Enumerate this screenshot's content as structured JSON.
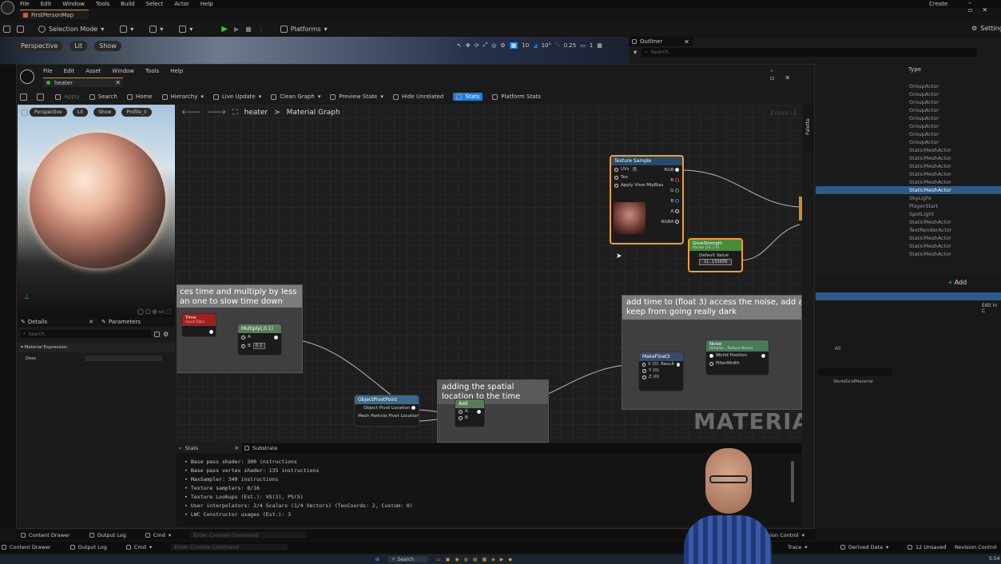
{
  "editor": {
    "menu": [
      "File",
      "Edit",
      "Window",
      "Tools",
      "Build",
      "Select",
      "Actor",
      "Help"
    ],
    "map_tab": "FirstPersonMap",
    "create": "Create",
    "selection_mode": "Selection Mode",
    "platforms": "Platforms",
    "settings": "Settings",
    "viewport_buttons": [
      "Perspective",
      "Lit",
      "Show"
    ],
    "outliner_title": "Outliner",
    "outliner_search": "Search",
    "type_header": "Type",
    "outliner_rows": [
      "GroupActor",
      "GroupActor",
      "GroupActor",
      "GroupActor",
      "GroupActor",
      "GroupActor",
      "GroupActor",
      "GroupActor",
      "StaticMeshActor",
      "StaticMeshActor",
      "StaticMeshActor",
      "StaticMeshActor",
      "StaticMeshActor",
      "StaticMeshActor",
      "SkyLight",
      "PlayerStart",
      "SpotLight",
      "StaticMeshActor",
      "TextRenderActor",
      "StaticMeshActor",
      "StaticMeshActor",
      "StaticMeshActor"
    ],
    "selected_row": 13,
    "add_label": "Add",
    "all_label": "All",
    "edit_in": "Edit in C",
    "world_grid": "WorldGridMaterial",
    "bottom": {
      "content_drawer": "Content Drawer",
      "output_log": "Output Log",
      "cmd": "Cmd",
      "console_placeholder": "Enter Console Command",
      "trace": "Trace",
      "derived_data": "Derived Data",
      "unsaved": "12 Unsaved",
      "revision_control": "Revision Control"
    },
    "taskbar_search": "Search",
    "clock": "5:54"
  },
  "mat": {
    "menu": [
      "File",
      "Edit",
      "Asset",
      "Window",
      "Tools",
      "Help"
    ],
    "tab": "heater",
    "toolbar": [
      "Apply",
      "Search",
      "Home",
      "Hierarchy",
      "Live Update",
      "Clean Graph",
      "Preview State",
      "Hide Unrelated",
      "Stats",
      "Platform Stats"
    ],
    "preview_buttons": [
      "Perspective",
      "Lit",
      "Show",
      "Profile_0"
    ],
    "breadcrumb": {
      "root": "heater",
      "sep": ">",
      "leaf": "Material Graph"
    },
    "zoom": "Zoom -1",
    "palette": "Palette",
    "details": {
      "tab": "Details",
      "params_tab": "Parameters",
      "search": "Search",
      "section": "Material Expression",
      "desc": "Desc"
    },
    "comments": {
      "c1": "ces time and multiply by less\nan one to slow time down",
      "c2": "adding the spatial\nlocation to the time",
      "c3": "add time to (float 3) access the noise, add a f\nkeep from going really dark"
    },
    "watermark": "MATERIAL",
    "nodes": {
      "texture": {
        "title": "Texture Sample",
        "uvs": "UVs",
        "uvs_val": "0",
        "tex": "Tex",
        "apply": "Apply View MipBias",
        "outs": [
          "RGB",
          "R",
          "G",
          "B",
          "A",
          "RGBA"
        ]
      },
      "glow": {
        "title": "GlowStrength",
        "sub": "Param (11.1.0)",
        "label": "Default Value",
        "value": "11.133099"
      },
      "time": {
        "title": "Time",
        "sub": "Input Data"
      },
      "multiply": {
        "title": "Multiply(,0.1)",
        "a": "A",
        "b": "B",
        "b_val": "0.1"
      },
      "objpivot": {
        "title": "ObjectPivotPoint",
        "o1": "Object Pivot Location",
        "o2": "Mesh Particle Pivot Location"
      },
      "add": {
        "title": "Add",
        "a": "A",
        "b": "B"
      },
      "make": {
        "title": "MakeFloat3",
        "x": "X (0)",
        "y": "Y (0)",
        "z": "Z (0)",
        "result": "Result"
      },
      "noise": {
        "title": "Noise",
        "sub": "Simplex - Texture Based",
        "wp": "World Position",
        "fw": "FilterWidth"
      }
    },
    "stats": {
      "tab": "Stats",
      "tab2": "Substrate",
      "lines": [
        "Base pass shader: 300 instructions",
        "Base pass vertex shader: 135 instructions",
        "MaxSampler: 349 instructions",
        "Texture samplers: 8/16",
        "Texture Lookups (Est.): VS(3), PS(5)",
        "User interpolators: 2/4 Scalars (1/4 Vectors) (TexCoords: 2, Custom: 0)",
        "LWC Constructor usages (Est.): 3"
      ]
    },
    "bottom": {
      "content_drawer": "Content Drawer",
      "output_log": "Output Log",
      "cmd": "Cmd",
      "console_placeholder": "Enter Console Command",
      "revision_control": "Revision Control"
    }
  },
  "colors": {
    "accent": "#1f7fd8",
    "selected_row": "#2e5a8a",
    "node_select": "#f0a030",
    "param_green": "#4a8a3a",
    "time_red": "#a02020"
  }
}
